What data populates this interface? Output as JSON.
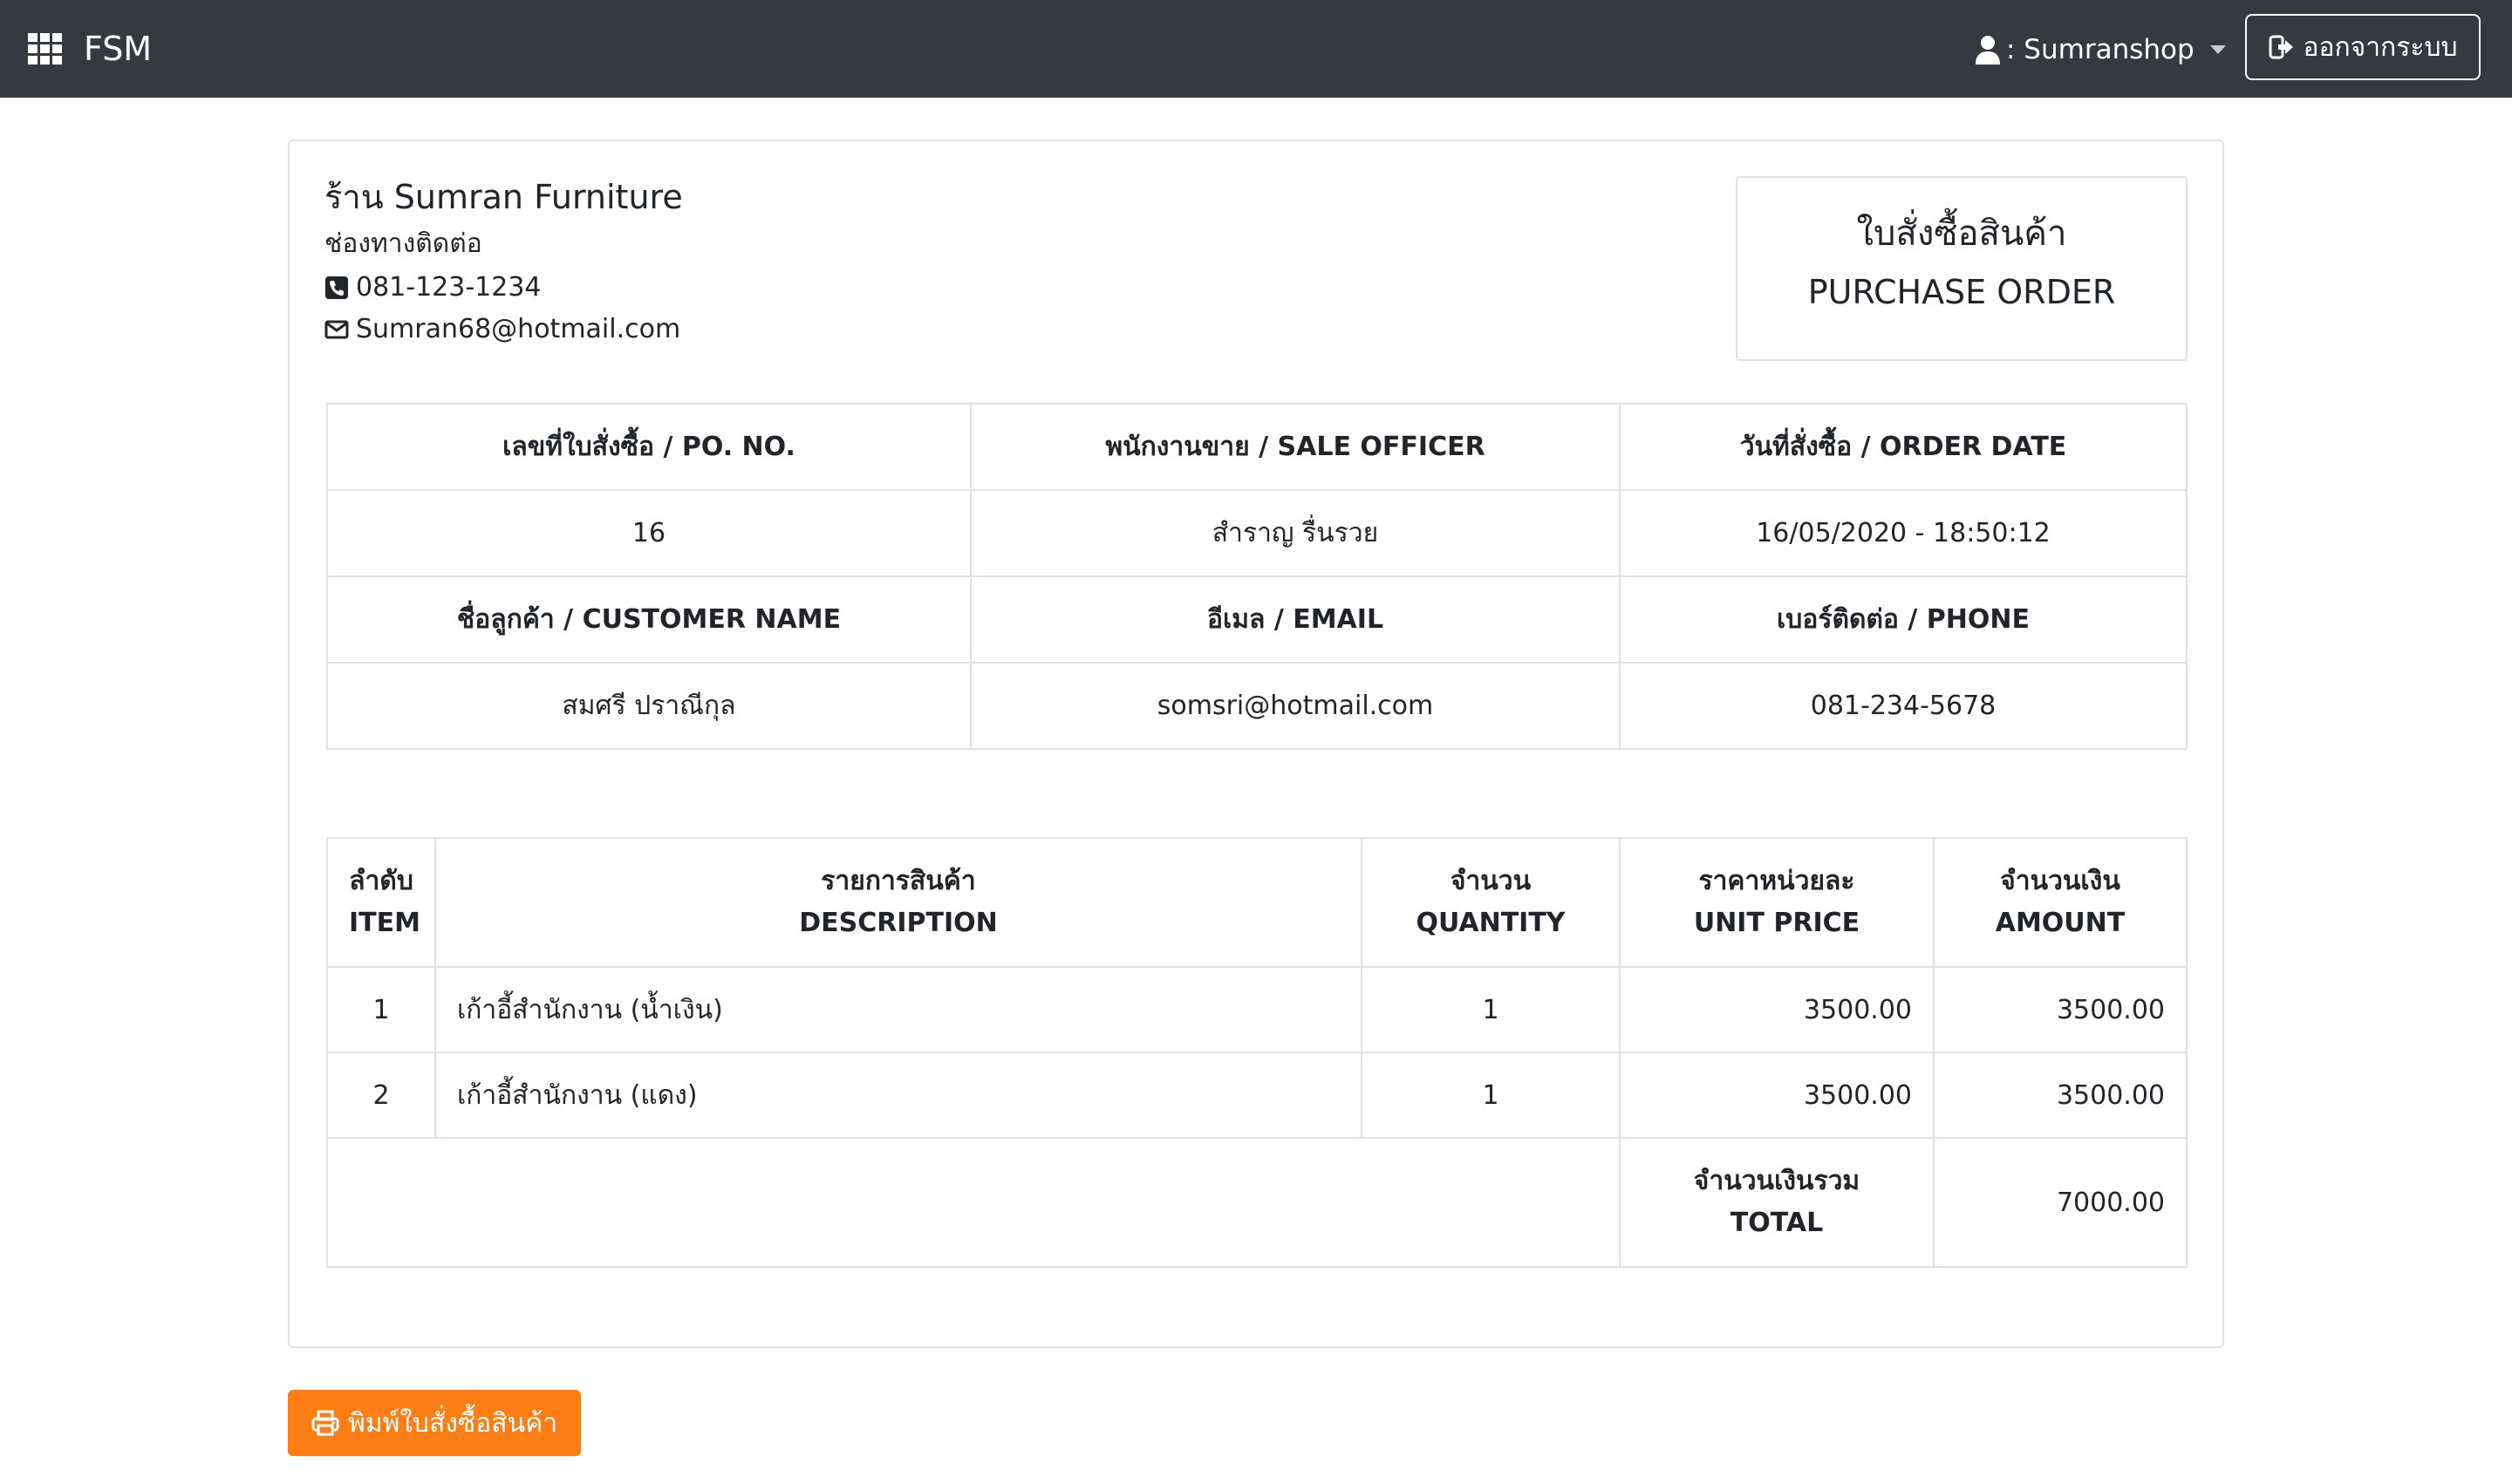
{
  "navbar": {
    "brand": "FSM",
    "user_label": ": Sumranshop",
    "logout_label": "ออกจากระบบ"
  },
  "shop": {
    "name": "ร้าน Sumran Furniture",
    "contact_title": "ช่องทางติดต่อ",
    "phone": "081-123-1234",
    "email": "Sumran68@hotmail.com"
  },
  "po_box": {
    "title_th": "ใบสั่งซื้อสินค้า",
    "title_en": "PURCHASE ORDER"
  },
  "info": {
    "po_no_label": "เลขที่ใบสั่งซื้อ / PO. NO.",
    "sale_officer_label": "พนักงานขาย / SALE OFFICER",
    "order_date_label": "วันที่สั่งซื้อ / ORDER DATE",
    "po_no": "16",
    "sale_officer": "สำราญ รื่นรวย",
    "order_date": "16/05/2020 - 18:50:12",
    "customer_name_label": "ชื่อลูกค้า / CUSTOMER NAME",
    "email_label": "อีเมล / EMAIL",
    "phone_label": "เบอร์ติดต่อ / PHONE",
    "customer_name": "สมศรี ปราณีกุล",
    "email": "somsri@hotmail.com",
    "phone": "081-234-5678"
  },
  "items_table": {
    "headers": [
      {
        "th": "ลำดับ",
        "en": "ITEM"
      },
      {
        "th": "รายการสินค้า",
        "en": "DESCRIPTION"
      },
      {
        "th": "จำนวน",
        "en": "QUANTITY"
      },
      {
        "th": "ราคาหน่วยละ",
        "en": "UNIT PRICE"
      },
      {
        "th": "จำนวนเงิน",
        "en": "AMOUNT"
      }
    ],
    "rows": [
      {
        "item": "1",
        "description": "เก้าอี้สำนักงาน (น้ำเงิน)",
        "quantity": "1",
        "unit_price": "3500.00",
        "amount": "3500.00"
      },
      {
        "item": "2",
        "description": "เก้าอี้สำนักงาน (แดง)",
        "quantity": "1",
        "unit_price": "3500.00",
        "amount": "3500.00"
      }
    ],
    "total_label_th": "จำนวนเงินรวม",
    "total_label_en": "TOTAL",
    "total_amount": "7000.00"
  },
  "print_button": {
    "label": "พิมพ์ใบสั่งซื้อสินค้า"
  },
  "colors": {
    "navbar": "#343a40",
    "print_button": "#fd7e14"
  }
}
